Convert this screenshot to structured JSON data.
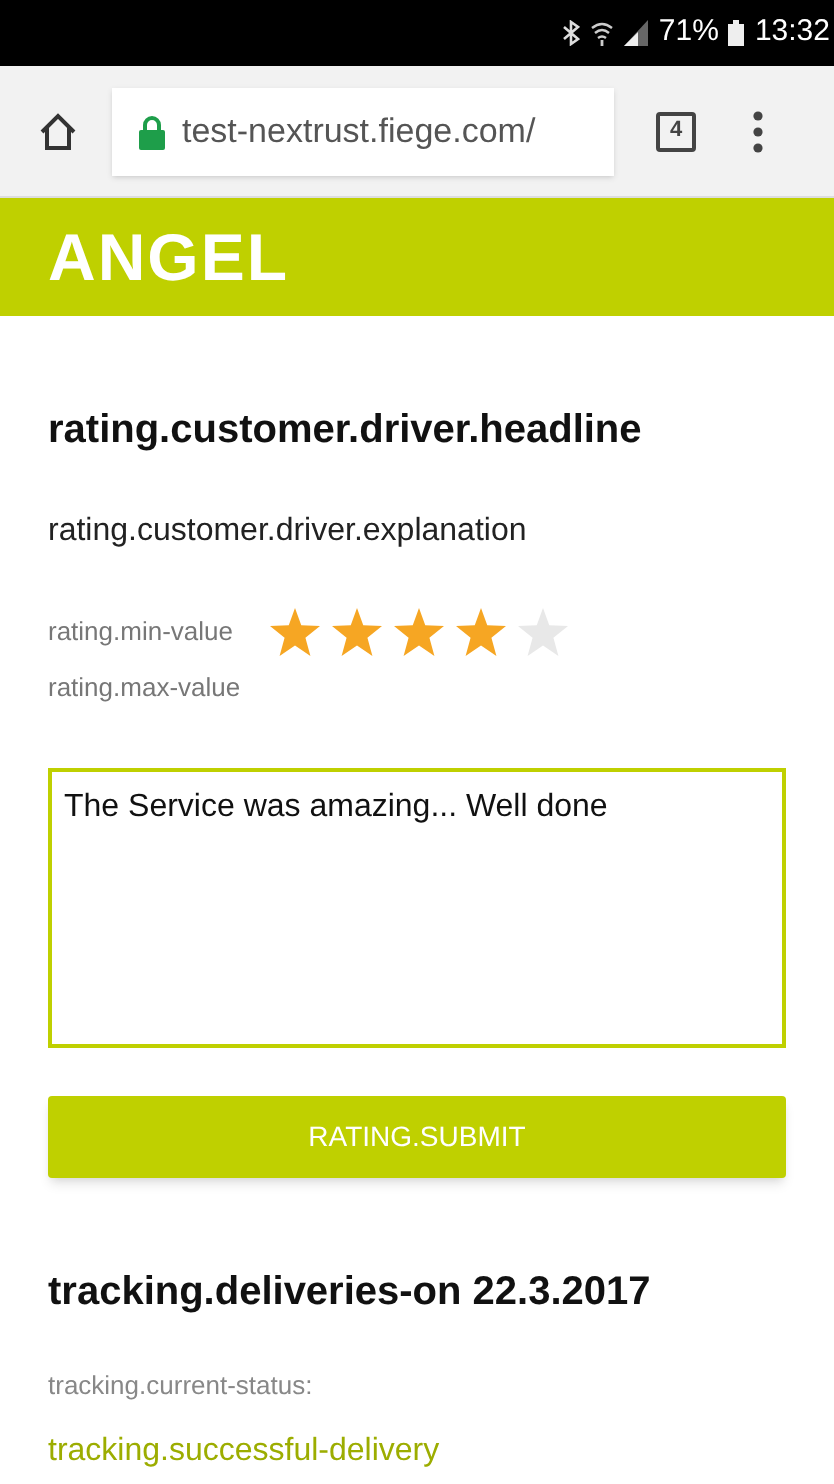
{
  "status_bar": {
    "battery": "71%",
    "time": "13:32"
  },
  "browser": {
    "url": "test-nextrust.fiege.com/",
    "tab_count": "4"
  },
  "header": {
    "logo": "ANGEL"
  },
  "rating": {
    "headline": "rating.customer.driver.headline",
    "explanation": "rating.customer.driver.explanation",
    "min_label": "rating.min-value",
    "max_label": "rating.max-value",
    "stars": 4,
    "comment": "The Service was amazing... Well done",
    "submit": "RATING.SUBMIT"
  },
  "tracking": {
    "headline": "tracking.deliveries-on 22.3.2017",
    "status_label": "tracking.current-status:",
    "status": "tracking.successful-delivery"
  }
}
